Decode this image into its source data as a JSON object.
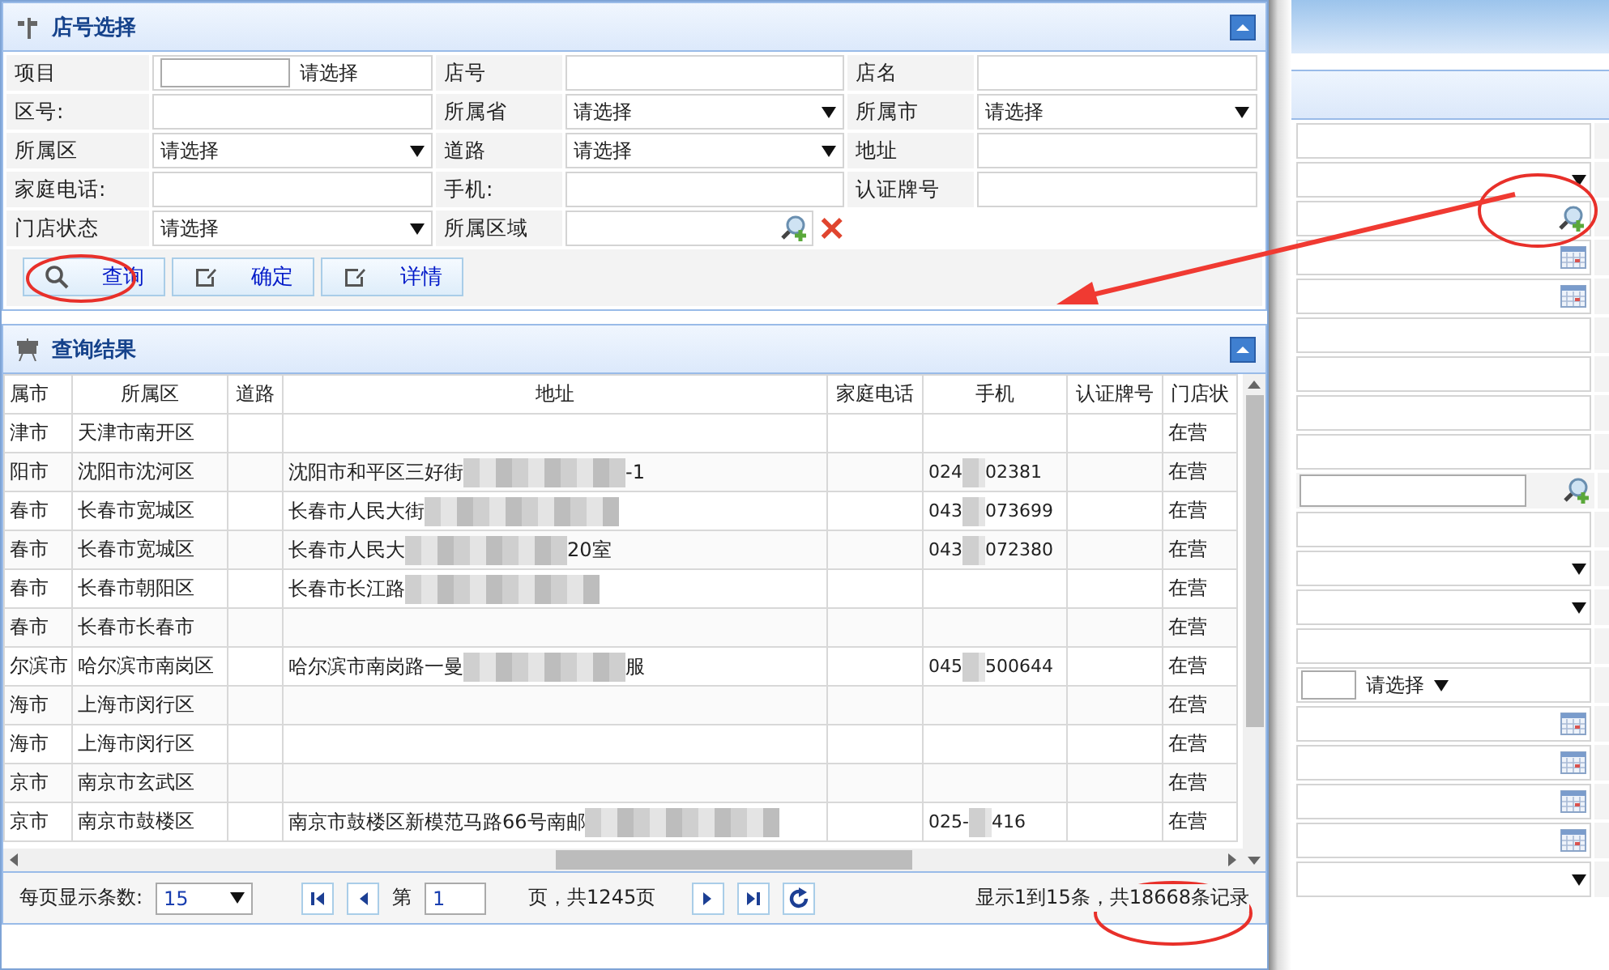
{
  "query_panel": {
    "title": "店号选择",
    "fields": [
      {
        "label": "项目",
        "kind": "choose",
        "value": "请选择"
      },
      {
        "label": "店号",
        "kind": "text"
      },
      {
        "label": "店名",
        "kind": "text"
      },
      {
        "label": "区号:",
        "kind": "text"
      },
      {
        "label": "所属省",
        "kind": "select",
        "value": "请选择"
      },
      {
        "label": "所属市",
        "kind": "select",
        "value": "请选择"
      },
      {
        "label": "所属区",
        "kind": "select",
        "value": "请选择"
      },
      {
        "label": "道路",
        "kind": "select",
        "value": "请选择"
      },
      {
        "label": "地址",
        "kind": "text"
      },
      {
        "label": "家庭电话:",
        "kind": "text"
      },
      {
        "label": "手机:",
        "kind": "text"
      },
      {
        "label": "认证牌号",
        "kind": "text"
      },
      {
        "label": "门店状态",
        "kind": "select",
        "value": "请选择"
      },
      {
        "label": "所属区域",
        "kind": "lookup"
      }
    ],
    "buttons": [
      {
        "label": "查询"
      },
      {
        "label": "确定"
      },
      {
        "label": "详情"
      }
    ]
  },
  "results_panel": {
    "title": "查询结果",
    "columns": [
      "属市",
      "所属区",
      "道路",
      "地址",
      "家庭电话",
      "手机",
      "认证牌号",
      "门店状"
    ],
    "rows": [
      {
        "cells": [
          "津市",
          "天津市南开区",
          "",
          "",
          "",
          "",
          "",
          "在营"
        ]
      },
      {
        "cells": [
          "阳市",
          "沈阳市沈河区",
          "",
          {
            "start": "沈阳市和平区三好街",
            "end": "-1"
          },
          "",
          {
            "start": "024",
            "end": "02381"
          },
          "",
          "在营"
        ]
      },
      {
        "cells": [
          "春市",
          "长春市宽城区",
          "",
          {
            "start": "长春市人民大街"
          },
          "",
          {
            "start": "043",
            "end": "073699"
          },
          "",
          "在营"
        ]
      },
      {
        "cells": [
          "春市",
          "长春市宽城区",
          "",
          {
            "start": "长春市人民大",
            "end": "20室"
          },
          "",
          {
            "start": "043",
            "end": "072380"
          },
          "",
          "在营"
        ]
      },
      {
        "cells": [
          "春市",
          "长春市朝阳区",
          "",
          {
            "start": "长春市长江路"
          },
          "",
          "",
          "",
          "在营"
        ]
      },
      {
        "cells": [
          "春市",
          "长春市长春市",
          "",
          "",
          "",
          "",
          "",
          "在营"
        ]
      },
      {
        "cells": [
          "尔滨市",
          "哈尔滨市南岗区",
          "",
          {
            "start": "哈尔滨市南岗路一曼",
            "end": "服"
          },
          "",
          {
            "start": "045",
            "end": "500644"
          },
          "",
          "在营"
        ]
      },
      {
        "cells": [
          "海市",
          "上海市闵行区",
          "",
          "",
          "",
          "",
          "",
          "在营"
        ]
      },
      {
        "cells": [
          "海市",
          "上海市闵行区",
          "",
          "",
          "",
          "",
          "",
          "在营"
        ]
      },
      {
        "cells": [
          "京市",
          "南京市玄武区",
          "",
          "",
          "",
          "",
          "",
          "在营"
        ]
      },
      {
        "cells": [
          "京市",
          "南京市鼓楼区",
          "",
          {
            "start": "南京市鼓楼区新模范马路66号南邮"
          },
          "",
          {
            "start": "025-",
            "end": "416"
          },
          "",
          "在营"
        ]
      }
    ]
  },
  "pager": {
    "page_size_label": "每页显示条数:",
    "page_size": "15",
    "page_label": "第",
    "page": "1",
    "page_total": "页，共1245页",
    "summary": "显示1到15条，共18668条记录"
  },
  "background_window": {
    "rows": [
      {
        "kind": "text"
      },
      {
        "kind": "select"
      },
      {
        "kind": "search"
      },
      {
        "kind": "date"
      },
      {
        "kind": "date"
      },
      {
        "kind": "text"
      },
      {
        "kind": "text"
      },
      {
        "kind": "text"
      },
      {
        "kind": "text"
      },
      {
        "kind": "lookup"
      },
      {
        "kind": "text"
      },
      {
        "kind": "select"
      },
      {
        "kind": "select"
      },
      {
        "kind": "text"
      },
      {
        "kind": "choose",
        "value": "请选择"
      },
      {
        "kind": "date"
      },
      {
        "kind": "date"
      },
      {
        "kind": "date"
      },
      {
        "kind": "date"
      },
      {
        "kind": "select"
      }
    ]
  }
}
